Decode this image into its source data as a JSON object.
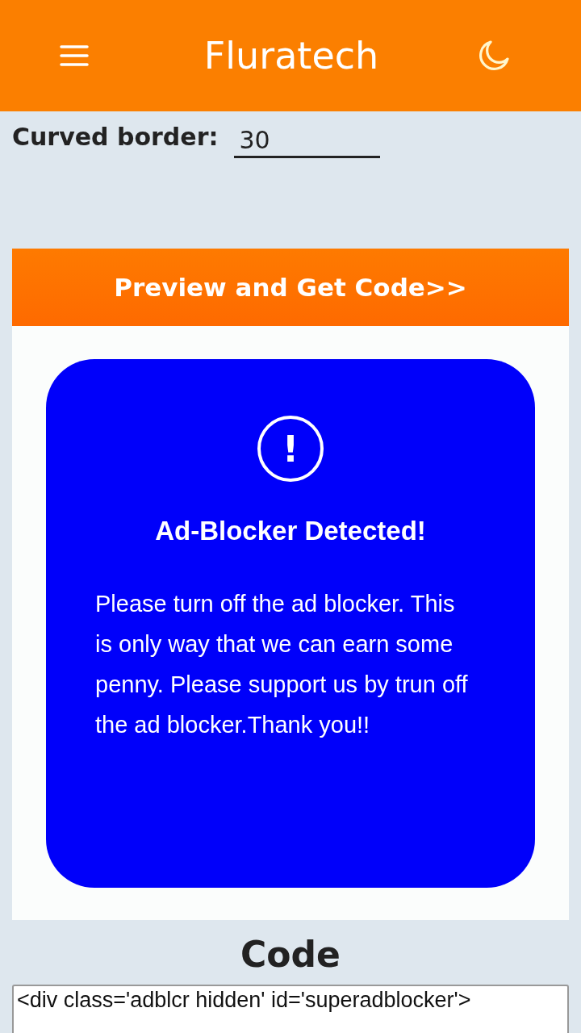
{
  "header": {
    "title": "Fluratech"
  },
  "curved_border": {
    "label": "Curved border:",
    "value": "30"
  },
  "preview_button": {
    "label": "Preview and Get Code>>"
  },
  "preview": {
    "title": "Ad-Blocker Detected!",
    "icon": "!",
    "message": "Please turn off the ad blocker. This is only way that we can earn some penny. Please support us by trun off the ad blocker.Thank you!!"
  },
  "code": {
    "heading": "Code",
    "value": "<div class='adblcr hidden' id='superadblocker'>"
  }
}
